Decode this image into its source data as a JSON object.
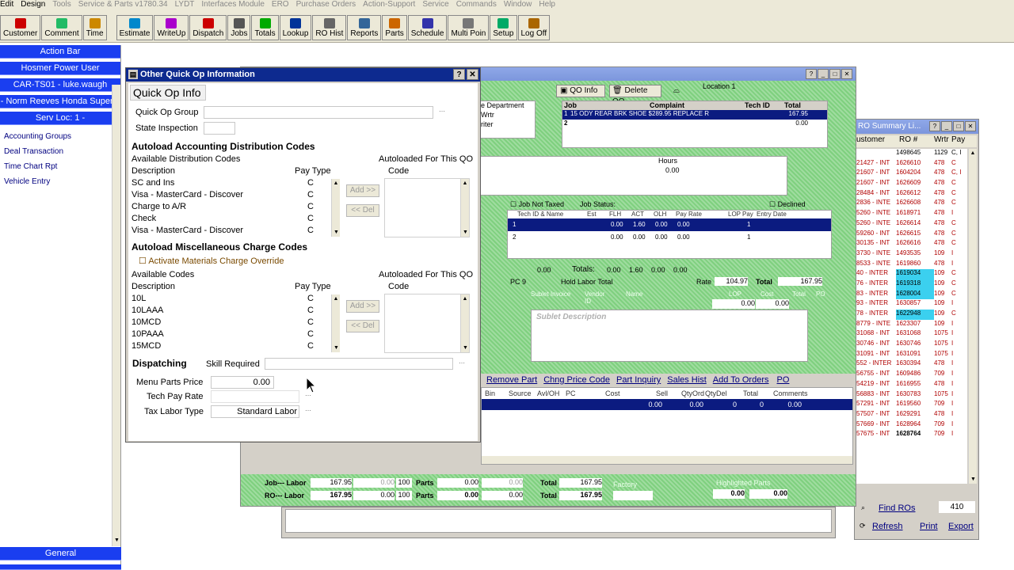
{
  "menu": [
    "Edit",
    "Design",
    "Tools",
    "Service & Parts v1780.34",
    "LYDT",
    "Interfaces Module",
    "ERO",
    "Purchase Orders",
    "Action-Support",
    "Service",
    "Commands",
    "Window",
    "Help"
  ],
  "toolbar": [
    "Customer",
    "Comment",
    "Time",
    "Estimate",
    "WriteUp",
    "Dispatch",
    "Jobs",
    "Totals",
    "Lookup",
    "RO Hist",
    "Reports",
    "Parts",
    "Schedule",
    "Multi Poin",
    "Setup",
    "Log Off"
  ],
  "left_panel": {
    "headers": [
      "Action Bar",
      "Hosmer Power User",
      "CAR-TS01 - luke.waugh",
      "- Norm Reeves Honda Superst",
      "Serv Loc: 1 -"
    ],
    "items": [
      "Accounting Groups",
      "Deal Transaction",
      "Time Chart Rpt",
      "Vehicle Entry"
    ],
    "bottom_header": "General"
  },
  "dialog": {
    "title": "Other Quick Op Information",
    "heading": "Quick Op Info",
    "quick_op_group_label": "Quick Op Group",
    "state_inspection_label": "State Inspection",
    "accounting": {
      "heading": "Autoload Accounting Distribution Codes",
      "available_label": "Available Distribution Codes",
      "autoloaded_label": "Autoloaded For This QO",
      "col_description": "Description",
      "col_pay_type": "Pay Type",
      "col_code": "Code",
      "rows": [
        {
          "desc": "SC and Ins",
          "pay": "C"
        },
        {
          "desc": "Visa - MasterCard - Discover",
          "pay": "C"
        },
        {
          "desc": "Charge to A/R",
          "pay": "C"
        },
        {
          "desc": "Check",
          "pay": "C"
        },
        {
          "desc": "Visa - MasterCard - Discover",
          "pay": "C"
        }
      ],
      "add_label": "Add >>",
      "remove_label": "<< Del"
    },
    "misc": {
      "heading": "Autoload Miscellaneous Charge Codes",
      "override_label": "Activate Materials Charge Override",
      "available_label": "Available Codes",
      "autoloaded_label": "Autoloaded For This QO",
      "col_description": "Description",
      "col_pay_type": "Pay Type",
      "col_code": "Code",
      "rows": [
        {
          "desc": "10L",
          "pay": "C"
        },
        {
          "desc": "10LAAA",
          "pay": "C"
        },
        {
          "desc": "10MCD",
          "pay": "C"
        },
        {
          "desc": "10PAAA",
          "pay": "C"
        },
        {
          "desc": "15MCD",
          "pay": "C"
        }
      ],
      "add_label": "Add >>",
      "remove_label": "<< Del"
    },
    "dispatching_heading": "Dispatching",
    "skill_required_label": "Skill Required",
    "menu_parts_price_label": "Menu Parts Price",
    "menu_parts_price_value": "0.00",
    "tech_pay_rate_label": "Tech Pay Rate",
    "tax_labor_type_label": "Tax Labor Type",
    "tax_labor_type_value": "Standard Labor"
  },
  "main": {
    "qo_info": "QO Info",
    "delete_qo": "Delete QO",
    "location": "Location 1",
    "dept_partial": "e Department",
    "wrtr_partial": "Wrtr",
    "writer_partial": "riter",
    "job_header": "Job",
    "complaint_header": "Complaint",
    "tech_id_header": "Tech ID",
    "total_header": "Total",
    "job_rows": [
      {
        "num": "1",
        "complaint": "15 ODY REAR BRK SHOE $289.95 REPLACE R",
        "total": "167.95"
      },
      {
        "num": "2",
        "complaint": "",
        "total": "0.00"
      }
    ],
    "hours_label": "Hours",
    "hours_value": "0.00",
    "job_not_taxed": "Job Not Taxed",
    "job_status": "Job Status:",
    "declined": "Declined",
    "labor_headers": [
      "Tech ID & Name",
      "Est",
      "FLH",
      "ACT",
      "OLH",
      "Pay Rate",
      "LOP",
      "Pay",
      "Entry Date"
    ],
    "labor_rows": [
      {
        "n": "1",
        "est": "0.00",
        "flh": "1.60",
        "act": "0.00",
        "olh": "0.00",
        "lop": "1"
      },
      {
        "n": "2",
        "est": "0.00",
        "flh": "0.00",
        "act": "0.00",
        "olh": "0.00",
        "lop": "1"
      }
    ],
    "totals_label": "Totals:",
    "totals_left": "0.00",
    "totals": {
      "est": "0.00",
      "flh": "1.60",
      "act": "0.00",
      "olh": "0.00"
    },
    "pc_label": "PC",
    "pc_value": "9",
    "hold_labor_total": "Hold Labor Total",
    "rate_label": "Rate",
    "rate_value": "104.97",
    "total_label": "Total",
    "total_value": "167.95",
    "sublet_headers": [
      "Sublet Invoice",
      "Vendor ID",
      "Name",
      "LOP",
      "Cost",
      "Total",
      "PO"
    ],
    "sublet_values": {
      "cost": "0.00",
      "total": "0.00"
    },
    "sublet_description": "Sublet Description",
    "parts_links": [
      "Remove Part",
      "Chng Price Code",
      "Part Inquiry",
      "Sales Hist",
      "Add To Orders",
      "PO"
    ],
    "parts_headers": [
      "Bin",
      "Source",
      "Avl/OH",
      "PC",
      "Cost",
      "Sell",
      "QtyOrd",
      "QtyDel",
      "Total",
      "Comments"
    ],
    "parts_row": {
      "cost": "0.00",
      "sell": "0.00",
      "qtyord": "0",
      "qtydel": "0",
      "total": "0.00"
    },
    "footer": {
      "job_label": "Job--- Labor",
      "ro_label": "RO--- Labor",
      "job_labor": "167.95",
      "job_labor2": "0.00",
      "job_pct": "100",
      "parts_label": "Parts",
      "job_parts": "0.00",
      "job_parts2": "0.00",
      "total_label": "Total",
      "job_total": "167.95",
      "ro_labor": "167.95",
      "ro_labor2": "0.00",
      "ro_pct": "100",
      "ro_parts": "0.00",
      "ro_parts2": "0.00",
      "ro_total": "167.95",
      "factory": "Factory",
      "highlighted_parts": "Highlighted Parts",
      "hp1": "0.00",
      "hp2": "0.00"
    }
  },
  "ro_summary": {
    "title": "RO Summary Li...",
    "headers": [
      "ustomer",
      "RO #",
      "Wrtr",
      "Pay"
    ],
    "rows": [
      {
        "c": "",
        "ro": "1498645",
        "w": "1129",
        "p": "C, I",
        "dark": true
      },
      {
        "c": "21427 - INT",
        "ro": "1626610",
        "w": "478",
        "p": "C"
      },
      {
        "c": "21607 - INT",
        "ro": "1604204",
        "w": "478",
        "p": "C, I"
      },
      {
        "c": "21607 - INT",
        "ro": "1626609",
        "w": "478",
        "p": "C"
      },
      {
        "c": "28484 - INT",
        "ro": "1626612",
        "w": "478",
        "p": "C"
      },
      {
        "c": "2836 - INTE",
        "ro": "1626608",
        "w": "478",
        "p": "C"
      },
      {
        "c": "5260 - INTE",
        "ro": "1618971",
        "w": "478",
        "p": "I"
      },
      {
        "c": "5260 - INTE",
        "ro": "1626614",
        "w": "478",
        "p": "C"
      },
      {
        "c": "59260 - INT",
        "ro": "1626615",
        "w": "478",
        "p": "C"
      },
      {
        "c": "30135 - INT",
        "ro": "1626616",
        "w": "478",
        "p": "C"
      },
      {
        "c": "3730 - INTE",
        "ro": "1493535",
        "w": "109",
        "p": "I"
      },
      {
        "c": "8533 - INTE",
        "ro": "1619860",
        "w": "478",
        "p": "I"
      },
      {
        "c": "40 - INTER",
        "ro": "1619034",
        "w": "109",
        "p": "C",
        "hl": true
      },
      {
        "c": "76 - INTER",
        "ro": "1619318",
        "w": "109",
        "p": "C",
        "hl": true
      },
      {
        "c": "83 - INTER",
        "ro": "1628004",
        "w": "109",
        "p": "C",
        "hl": true
      },
      {
        "c": "93 - INTER",
        "ro": "1630857",
        "w": "109",
        "p": "I"
      },
      {
        "c": "78 - INTER",
        "ro": "1622948",
        "w": "109",
        "p": "C",
        "hl": true
      },
      {
        "c": "8779 - INTE",
        "ro": "1623307",
        "w": "109",
        "p": "I"
      },
      {
        "c": "31068 - INT",
        "ro": "1631068",
        "w": "1075",
        "p": "I"
      },
      {
        "c": "30746 - INT",
        "ro": "1630746",
        "w": "1075",
        "p": "I"
      },
      {
        "c": "31091 - INT",
        "ro": "1631091",
        "w": "1075",
        "p": "I"
      },
      {
        "c": "552 - INTER",
        "ro": "1630394",
        "w": "478",
        "p": "I"
      },
      {
        "c": "56755 - INT",
        "ro": "1609486",
        "w": "709",
        "p": "I"
      },
      {
        "c": "54219 - INT",
        "ro": "1616955",
        "w": "478",
        "p": "I"
      },
      {
        "c": "56883 - INT",
        "ro": "1630783",
        "w": "1075",
        "p": "I"
      },
      {
        "c": "57291 - INT",
        "ro": "1619560",
        "w": "709",
        "p": "I"
      },
      {
        "c": "57507 - INT",
        "ro": "1629291",
        "w": "478",
        "p": "I"
      },
      {
        "c": "57669 - INT",
        "ro": "1628964",
        "w": "709",
        "p": "I"
      },
      {
        "c": "57675 - INT",
        "ro": "1628764",
        "w": "709",
        "p": "I",
        "bold": true
      }
    ],
    "find_label": "Find ROs",
    "find_value": "410",
    "refresh": "Refresh",
    "print": "Print",
    "export": "Export"
  }
}
